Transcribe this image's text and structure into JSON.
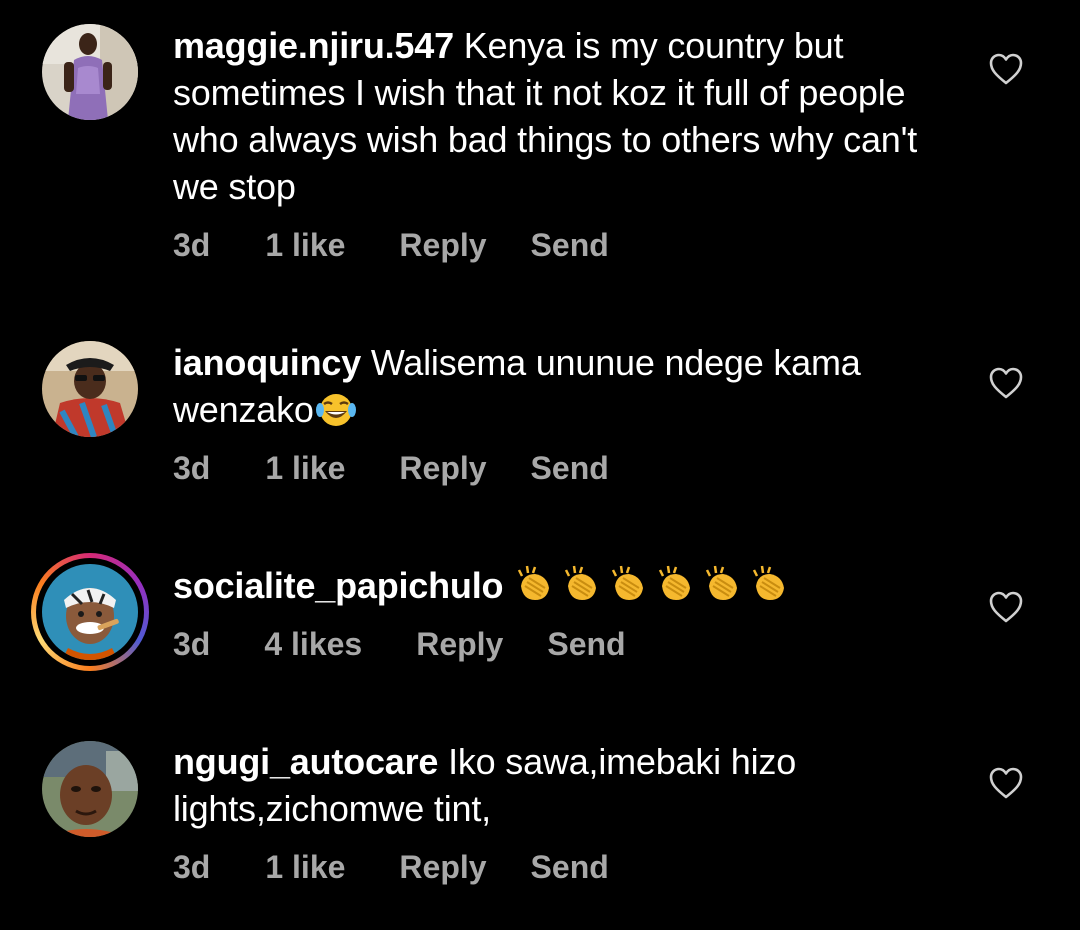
{
  "colors": {
    "background": "#000000",
    "text": "#ffffff",
    "meta": "#a8a8a8"
  },
  "comments": [
    {
      "username": "maggie.njiru.547",
      "text": "Kenya is my country but sometimes I wish that it not koz it full of people who always wish bad things to others why can't we stop",
      "time": "3d",
      "likes": "1 like",
      "reply": "Reply",
      "send": "Send",
      "icon": "heart-outline-icon"
    },
    {
      "username": "ianoquincy",
      "text": "Walisema ununue ndege kama wenzako",
      "emoji": "😂",
      "time": "3d",
      "likes": "1 like",
      "reply": "Reply",
      "send": "Send",
      "icon": "heart-outline-icon"
    },
    {
      "username": "socialite_papichulo",
      "text": "",
      "emoji": "👏👏👏👏👏👏",
      "time": "3d",
      "likes": "4 likes",
      "reply": "Reply",
      "send": "Send",
      "has_story_ring": true,
      "icon": "heart-outline-icon"
    },
    {
      "username": "ngugi_autocare",
      "text": "Iko sawa,imebaki hizo lights,zichomwe tint,",
      "time": "3d",
      "likes": "1 like",
      "reply": "Reply",
      "send": "Send",
      "icon": "heart-outline-icon"
    }
  ]
}
